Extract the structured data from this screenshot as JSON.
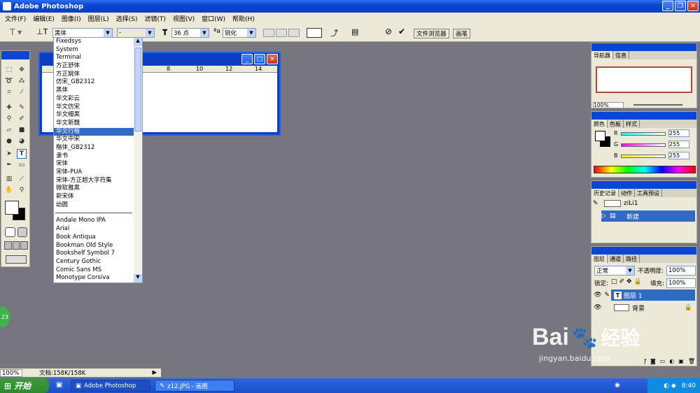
{
  "app": {
    "title": "Adobe Photoshop"
  },
  "menu": [
    "文件(F)",
    "编辑(E)",
    "图像(I)",
    "图层(L)",
    "选择(S)",
    "滤镜(T)",
    "视图(V)",
    "窗口(W)",
    "帮助(H)"
  ],
  "options": {
    "font_family": "黑体",
    "font_style": "-",
    "font_size": "36 点",
    "antialias": "锐化",
    "tabs": [
      "文件浏览器",
      "画笔"
    ]
  },
  "font_list": {
    "cjk": [
      "Fixedsys",
      "System",
      "Terminal",
      "方正舒体",
      "方正姚体",
      "仿宋_GB2312",
      "黑体",
      "华文彩云",
      "华文仿宋",
      "华文细黑",
      "华文新魏",
      "华文行楷",
      "华文中宋",
      "楷体_GB2312",
      "隶书",
      "宋体",
      "宋体-PUA",
      "宋体-方正超大字符集",
      "微软雅黑",
      "新宋体",
      "幼圆"
    ],
    "selected": "华文行楷",
    "latin": [
      "Andale Mono IPA",
      "Arial",
      "Book Antiqua",
      "Bookman Old Style",
      "Bookshelf Symbol 7",
      "Century Gothic",
      "Comic Sans MS",
      "Monotype Corsiva"
    ]
  },
  "ruler": [
    "8",
    "10",
    "12",
    "14"
  ],
  "navigator": {
    "tabs": [
      "导航器",
      "信息"
    ],
    "zoom": "100%"
  },
  "color": {
    "tabs": [
      "颜色",
      "色板",
      "样式"
    ],
    "channels": [
      {
        "label": "R",
        "value": "255"
      },
      {
        "label": "G",
        "value": "255"
      },
      {
        "label": "B",
        "value": "255"
      }
    ]
  },
  "history": {
    "tabs": [
      "历史记录",
      "动作",
      "工具预设"
    ],
    "snapshot": "ziLi1",
    "items": [
      "新建"
    ]
  },
  "layers": {
    "tabs": [
      "图层",
      "通道",
      "路径"
    ],
    "blend": "正常",
    "opacity_label": "不透明度:",
    "opacity": "100%",
    "lock_label": "锁定:",
    "fill_label": "填充:",
    "fill": "100%",
    "items": [
      "图层 1",
      "背景"
    ]
  },
  "status": {
    "zoom": "100%",
    "doc": "文档:158K/158K"
  },
  "taskbar": {
    "start": "开始",
    "tasks": [
      "Adobe Photoshop",
      "z12.JPG - 画图"
    ],
    "time": "8:40"
  },
  "badge": "23",
  "watermark": {
    "brand": "Bai",
    "brand2": "经验",
    "url": "jingyan.baidu.com"
  }
}
